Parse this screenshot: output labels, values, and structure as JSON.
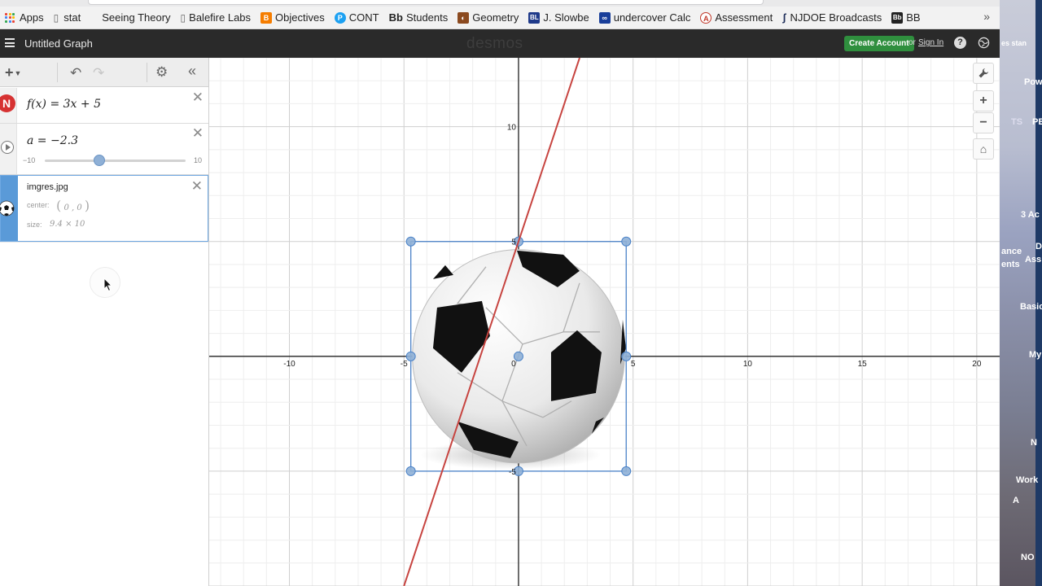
{
  "bookmarks": {
    "items": [
      {
        "label": "Apps",
        "icon": "apps-grid-icon"
      },
      {
        "label": "stat",
        "icon": "page-icon"
      },
      {
        "label": "Seeing Theory",
        "icon": "none"
      },
      {
        "label": "Balefire Labs",
        "icon": "page-icon"
      },
      {
        "label": "Objectives",
        "icon": "blogger-icon",
        "color": "#f57d00"
      },
      {
        "label": "CONT",
        "icon": "p-circle-icon",
        "color": "#1da1f2"
      },
      {
        "label": "Students",
        "icon": "bb-icon",
        "prefix": "Bb"
      },
      {
        "label": "Geometry",
        "icon": "geometry-icon",
        "color": "#8b4a1f"
      },
      {
        "label": "J. Slowbe",
        "icon": "bl-icon",
        "prefix": "BL",
        "color": "#1f3a8a"
      },
      {
        "label": "undercover Calc",
        "icon": "infinity-icon",
        "color": "#1a3f9a"
      },
      {
        "label": "Assessment",
        "icon": "a-circle-icon",
        "color": "#c0392b"
      },
      {
        "label": "NJDOE Broadcasts",
        "icon": "nj-icon"
      },
      {
        "label": "BB",
        "icon": "bb-icon",
        "prefix": "Bb"
      }
    ],
    "more": "»"
  },
  "side_peek": {
    "texts": [
      "es stan",
      "Pow",
      "PB",
      "TS",
      "3 Ac",
      "D",
      "ance",
      "ents",
      "Ass",
      "Basic",
      "My",
      "N",
      "Work",
      "A",
      "NO"
    ]
  },
  "header": {
    "menu_icon": "hamburger-icon",
    "title": "Untitled Graph",
    "brand": "desmos",
    "create_account": "Create Account",
    "or": "or",
    "sign_in": "Sign In",
    "help": "?",
    "globe_icon": "globe-icon"
  },
  "toolbar": {
    "add": "+",
    "undo_icon": "undo-icon",
    "redo_icon": "redo-icon",
    "settings_icon": "gear-icon",
    "collapse": "«"
  },
  "expressions": [
    {
      "type": "function",
      "latex": "f(x) = 3x + 5",
      "lhs": "f",
      "arg": "x",
      "rhs_coef": "3x",
      "rhs_const": "5",
      "color": "#c74440",
      "logo": "N"
    },
    {
      "type": "slider",
      "var": "a",
      "value": "−2.3",
      "value_num": -2.3,
      "min": "−10",
      "max": "10",
      "min_num": -10,
      "max_num": 10
    },
    {
      "type": "image",
      "name": "imgres.jpg",
      "center_label": "center:",
      "center": "0 , 0",
      "size_label": "size:",
      "size": "9.4  ×  10"
    }
  ],
  "graph": {
    "x_min": -13.5,
    "x_max": 21,
    "y_min": -10,
    "y_max": 13,
    "x_ticks": [
      "-10",
      "-5",
      "0",
      "5",
      "10",
      "15",
      "20"
    ],
    "y_ticks": [
      "10",
      "5",
      "-5"
    ],
    "line_color": "#c74440",
    "image_center": [
      0,
      0
    ],
    "image_width": 9.4,
    "image_height": 10,
    "selection_color": "#4a82c8"
  },
  "graph_controls": [
    "wrench-icon",
    "zoom-in-icon",
    "zoom-out-icon",
    "home-icon"
  ],
  "graph_control_labels": {
    "wrench": "🔧",
    "zoom_in": "+",
    "zoom_out": "−",
    "home": "⌂"
  }
}
